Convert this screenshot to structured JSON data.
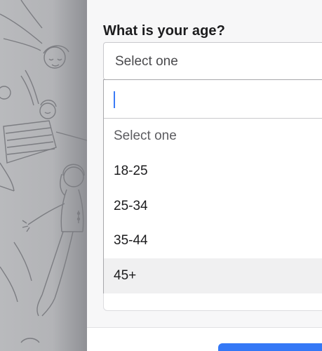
{
  "question": {
    "label": "What is your age?",
    "selected": "Select one"
  },
  "dropdown": {
    "search_value": "",
    "options": [
      {
        "label": "Select one"
      },
      {
        "label": "18-25"
      },
      {
        "label": "25-34"
      },
      {
        "label": "35-44"
      },
      {
        "label": "45+"
      }
    ],
    "highlighted_option": "45+"
  },
  "colors": {
    "accent": "#3478f6",
    "backdrop": "#b4b5b8"
  }
}
